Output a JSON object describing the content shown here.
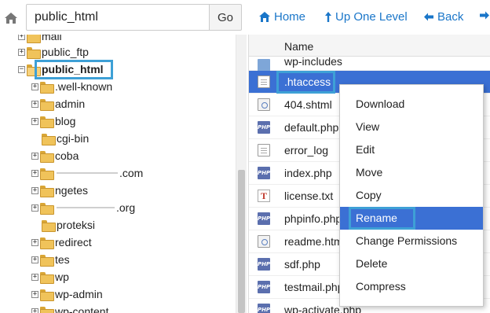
{
  "toolbar": {
    "path_value": "public_html",
    "go_label": "Go",
    "home_label": "Home",
    "up_label": "Up One Level",
    "back_label": "Back",
    "home_icon": "home-icon",
    "up_icon": "arrow-up-icon",
    "back_icon": "arrow-left-icon"
  },
  "tree": {
    "nodes": [
      {
        "label": "mail"
      },
      {
        "label": "public_ftp"
      },
      {
        "label": "public_html"
      },
      {
        "label": ".well-known"
      },
      {
        "label": "admin"
      },
      {
        "label": "blog"
      },
      {
        "label": "cgi-bin"
      },
      {
        "label": "coba"
      },
      {
        "label": ".com"
      },
      {
        "label": "ngetes"
      },
      {
        "label": ".org"
      },
      {
        "label": "proteksi"
      },
      {
        "label": "redirect"
      },
      {
        "label": "tes"
      },
      {
        "label": "wp"
      },
      {
        "label": "wp-admin"
      },
      {
        "label": "wp-content"
      }
    ]
  },
  "list": {
    "header_name": "Name",
    "files": [
      {
        "name": "wp-includes",
        "icon": "folder-icon"
      },
      {
        "name": ".htaccess",
        "icon": "text-file-icon"
      },
      {
        "name": "404.shtml",
        "icon": "html-file-icon"
      },
      {
        "name": "default.php",
        "icon": "php-file-icon"
      },
      {
        "name": "error_log",
        "icon": "text-file-icon"
      },
      {
        "name": "index.php",
        "icon": "php-file-icon"
      },
      {
        "name": "license.txt",
        "icon": "txt-file-icon"
      },
      {
        "name": "phpinfo.php",
        "icon": "php-file-icon"
      },
      {
        "name": "readme.html",
        "icon": "html-file-icon"
      },
      {
        "name": "sdf.php",
        "icon": "php-file-icon"
      },
      {
        "name": "testmail.php",
        "icon": "php-file-icon"
      },
      {
        "name": "wp-activate.php",
        "icon": "php-file-icon"
      }
    ],
    "php_badge": "PHP",
    "txt_badge": "T"
  },
  "context_menu": {
    "items": [
      {
        "label": "Download"
      },
      {
        "label": "View"
      },
      {
        "label": "Edit"
      },
      {
        "label": "Move"
      },
      {
        "label": "Copy"
      },
      {
        "label": "Rename"
      },
      {
        "label": "Change Permissions"
      },
      {
        "label": "Delete"
      },
      {
        "label": "Compress"
      }
    ]
  },
  "colors": {
    "accent": "#1a76c9",
    "selection": "#3b70d4",
    "highlight_border": "#3ea0d6",
    "folder": "#f0c35a"
  }
}
